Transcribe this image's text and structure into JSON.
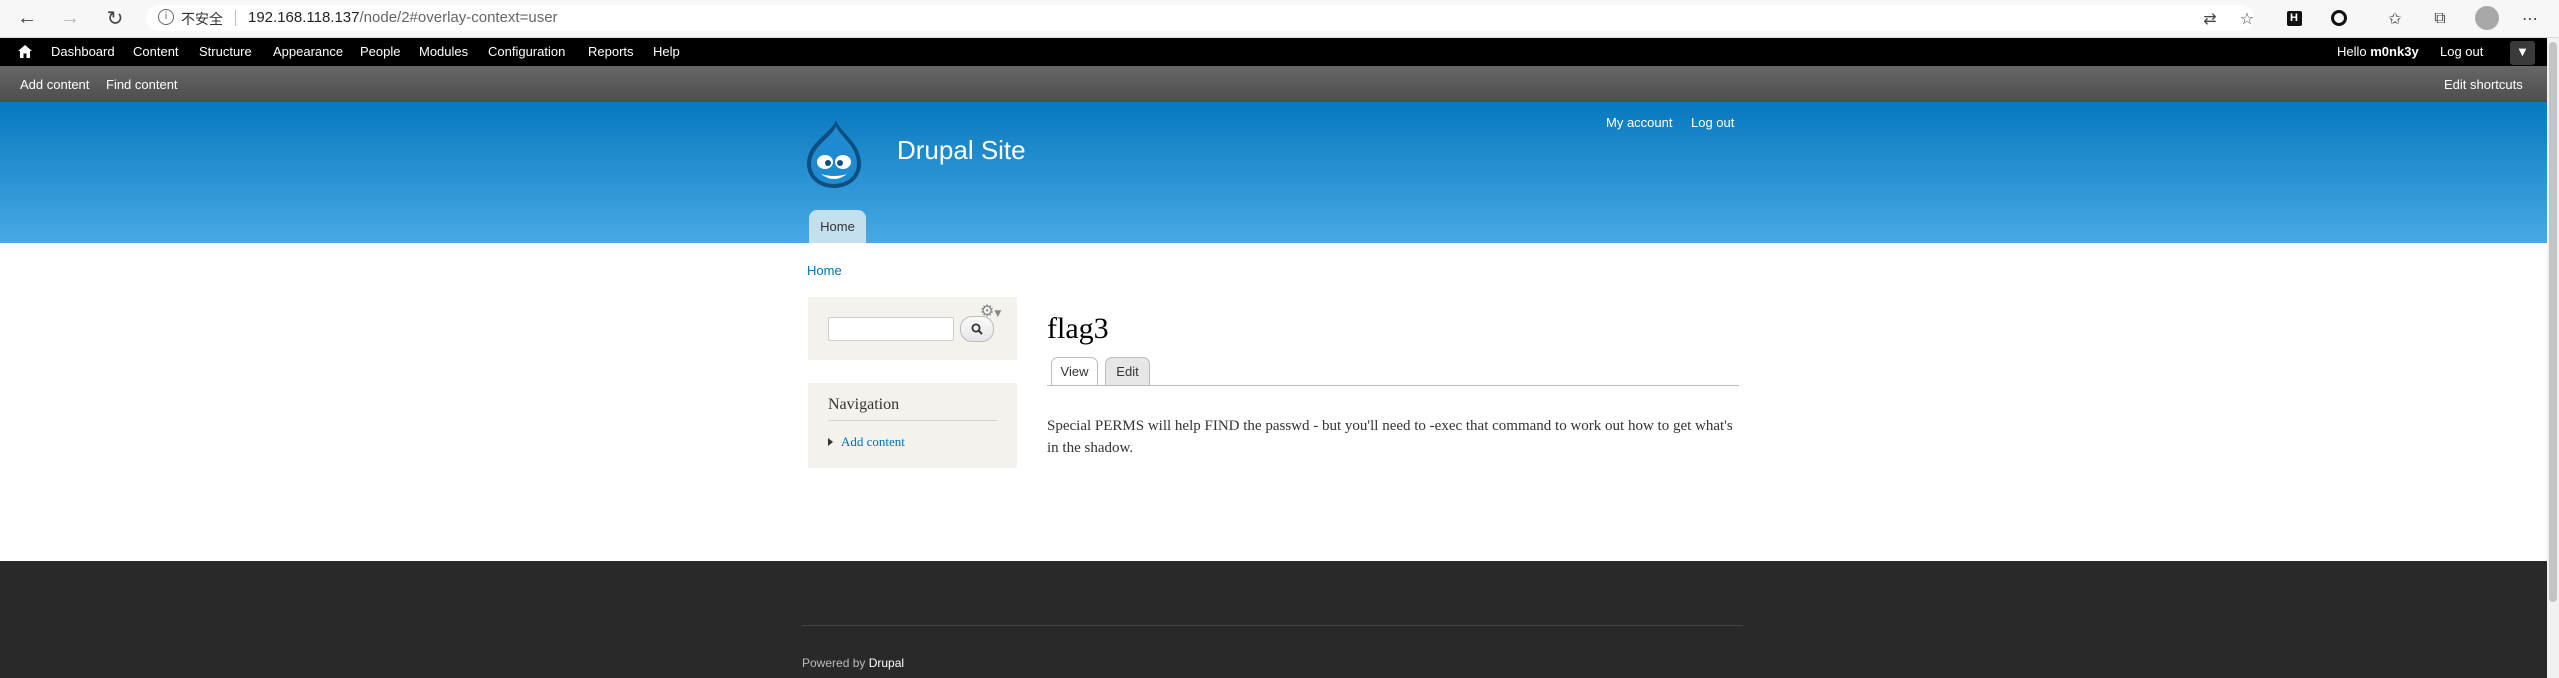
{
  "browser": {
    "security_label": "不安全",
    "url_host": "192.168.118.137",
    "url_path": "/node/2#overlay-context=user"
  },
  "admin_toolbar": {
    "items": [
      "Dashboard",
      "Content",
      "Structure",
      "Appearance",
      "People",
      "Modules",
      "Configuration",
      "Reports",
      "Help"
    ],
    "greeting": "Hello",
    "username": "m0nk3y",
    "logout": "Log out"
  },
  "shortcuts": {
    "items": [
      "Add content",
      "Find content"
    ],
    "edit": "Edit shortcuts"
  },
  "site": {
    "name": "Drupal Site",
    "secondary_menu": [
      "My account",
      "Log out"
    ],
    "main_menu": [
      "Home"
    ]
  },
  "breadcrumb": "Home",
  "sidebar": {
    "navigation_title": "Navigation",
    "navigation_items": [
      "Add content"
    ]
  },
  "node": {
    "title": "flag3",
    "tabs": [
      "View",
      "Edit"
    ],
    "body": "Special PERMS will help FIND the passwd - but you'll need to -exec that command to work out how to get what's in the shadow."
  },
  "footer": {
    "powered_prefix": "Powered by",
    "powered_link": "Drupal"
  }
}
